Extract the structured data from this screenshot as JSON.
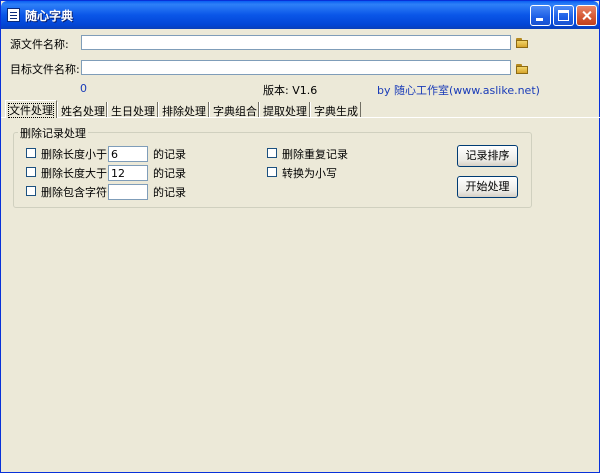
{
  "window": {
    "title": "随心字典"
  },
  "paths": {
    "source_label": "源文件名称:",
    "source_value": "",
    "target_label": "目标文件名称:",
    "target_value": ""
  },
  "status": {
    "count": "0",
    "version": "版本: V1.6",
    "author": "by 随心工作室(www.aslike.net)"
  },
  "tabs": [
    "文件处理",
    "姓名处理",
    "生日处理",
    "排除处理",
    "字典组合",
    "提取处理",
    "字典生成"
  ],
  "group": {
    "title": "删除记录处理",
    "rows": [
      {
        "label": "删除长度小于",
        "value": "6",
        "suffix": "的记录"
      },
      {
        "label": "删除长度大于",
        "value": "12",
        "suffix": "的记录"
      },
      {
        "label": "删除包含字符",
        "value": "",
        "suffix": "的记录"
      }
    ],
    "options": [
      "删除重复记录",
      "转换为小写"
    ],
    "sort_button": "记录排序",
    "start_button": "开始处理"
  }
}
